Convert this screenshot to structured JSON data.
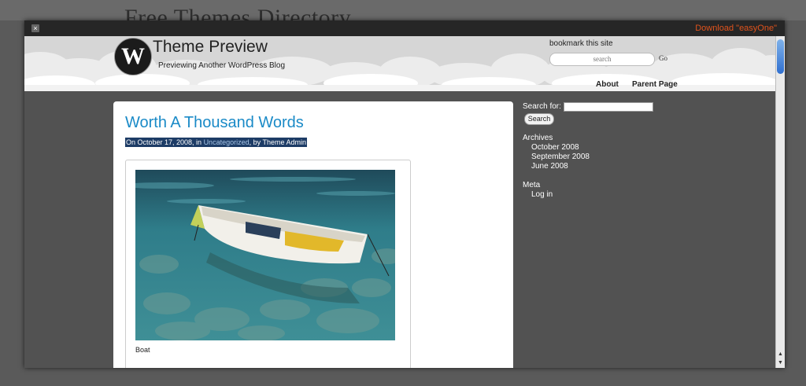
{
  "backdrop": {
    "title": "Free Themes Directory"
  },
  "modal": {
    "close_label": "×",
    "download_label": "Download \"easyOne\""
  },
  "header": {
    "logo_letter": "W",
    "title": "Theme Preview",
    "description": "Previewing Another WordPress Blog",
    "bookmark": "bookmark this site",
    "search_placeholder": "search",
    "go_label": "Go",
    "nav": [
      {
        "label": "About"
      },
      {
        "label": "Parent Page"
      }
    ]
  },
  "post": {
    "title": "Worth A Thousand Words",
    "meta_prefix": "On October 17, 2008, in ",
    "meta_category": "Uncategorized",
    "meta_suffix": ", by Theme Admin",
    "caption": "Boat"
  },
  "sidebar": {
    "search_label": "Search for:",
    "search_button": "Search",
    "archives_heading": "Archives",
    "archives": [
      "October 2008",
      "September 2008",
      "June 2008"
    ],
    "meta_heading": "Meta",
    "meta_links": [
      "Log in"
    ]
  },
  "scrollbar": {
    "up_label": "▲",
    "down_label": "▼"
  },
  "colors": {
    "accent_link": "#1a8ac7",
    "download": "#e0531c",
    "meta_highlight": "#1d3c66"
  }
}
